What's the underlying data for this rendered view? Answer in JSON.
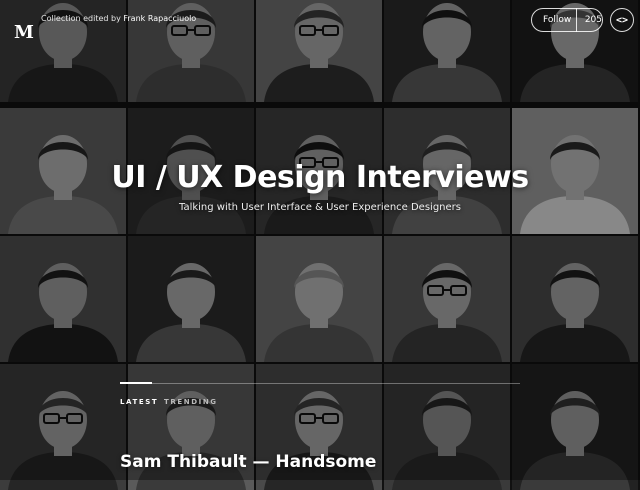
{
  "brand": {
    "logo_letter": "M"
  },
  "collection": {
    "editor_prefix": "Collection edited by",
    "editor_name": "Frank Rapacciuolo",
    "title": "UI / UX Design Interviews",
    "subtitle": "Talking with User Interface & User Experience Designers"
  },
  "follow": {
    "label": "Follow",
    "count": "205"
  },
  "code_button": {
    "icon": "code-brackets-icon",
    "glyph": "<>"
  },
  "tabs": {
    "latest": "LATEST",
    "trending": "TRENDING"
  },
  "latest_post": {
    "title": "Sam Thibault — Handsome"
  },
  "mosaic": {
    "rows": 4,
    "cols": 5,
    "tiles": [
      {
        "bg": "#3a3a3a",
        "skin": "#8f8f8f",
        "hair": "#1c1c1c",
        "shirt": "#262626",
        "glasses": false
      },
      {
        "bg": "#5a5a5a",
        "skin": "#9a9a9a",
        "hair": "#2c2c2c",
        "shirt": "#4a4a4a",
        "glasses": true
      },
      {
        "bg": "#6f6f6f",
        "skin": "#a5a5a5",
        "hair": "#3a3a3a",
        "shirt": "#303030",
        "glasses": true
      },
      {
        "bg": "#2a2a2a",
        "skin": "#a0a0a0",
        "hair": "#1a1a1a",
        "shirt": "#5a5a5a",
        "glasses": false
      },
      {
        "bg": "#1e1e1e",
        "skin": "#a8a8a8",
        "hair": "#555555",
        "shirt": "#3a3a3a",
        "glasses": false
      },
      {
        "bg": "#5e5e5e",
        "skin": "#b0b0b0",
        "hair": "#262626",
        "shirt": "#777777",
        "glasses": false
      },
      {
        "bg": "#2e2e2e",
        "skin": "#808080",
        "hair": "#222222",
        "shirt": "#3c3c3c",
        "glasses": false
      },
      {
        "bg": "#3e3e3e",
        "skin": "#9c9c9c",
        "hair": "#181818",
        "shirt": "#2a2a2a",
        "glasses": true
      },
      {
        "bg": "#4a4a4a",
        "skin": "#a5a5a5",
        "hair": "#333333",
        "shirt": "#6a6a6a",
        "glasses": false
      },
      {
        "bg": "#9a9a9a",
        "skin": "#b8b8b8",
        "hair": "#2a2a2a",
        "shirt": "#dcdcdc",
        "glasses": false
      },
      {
        "bg": "#4e4e4e",
        "skin": "#9a9a9a",
        "hair": "#1e1e1e",
        "shirt": "#1e1e1e",
        "glasses": false
      },
      {
        "bg": "#2c2c2c",
        "skin": "#a8a8a8",
        "hair": "#2a2a2a",
        "shirt": "#5a5a5a",
        "glasses": false
      },
      {
        "bg": "#6e6e6e",
        "skin": "#b5b5b5",
        "hair": "#8a8a8a",
        "shirt": "#555555",
        "glasses": false
      },
      {
        "bg": "#5a5a5a",
        "skin": "#a8a8a8",
        "hair": "#1a1a1a",
        "shirt": "#3a3a3a",
        "glasses": true
      },
      {
        "bg": "#4a4a4a",
        "skin": "#a0a0a0",
        "hair": "#1e1e1e",
        "shirt": "#262626",
        "glasses": false
      },
      {
        "bg": "#3c3c3c",
        "skin": "#a0a0a0",
        "hair": "#3a3a3a",
        "shirt": "#262626",
        "glasses": true
      },
      {
        "bg": "#5a5a5a",
        "skin": "#9a9a9a",
        "hair": "#2a2a2a",
        "shirt": "#3a3a3a",
        "glasses": false
      },
      {
        "bg": "#4a4a4a",
        "skin": "#a5a5a5",
        "hair": "#3a3a3a",
        "shirt": "#262626",
        "glasses": true
      },
      {
        "bg": "#3a3a3a",
        "skin": "#8a8a8a",
        "hair": "#262626",
        "shirt": "#2a2a2a",
        "glasses": false
      },
      {
        "bg": "#222222",
        "skin": "#9a9a9a",
        "hair": "#333333",
        "shirt": "#3a3a3a",
        "glasses": false
      }
    ]
  }
}
